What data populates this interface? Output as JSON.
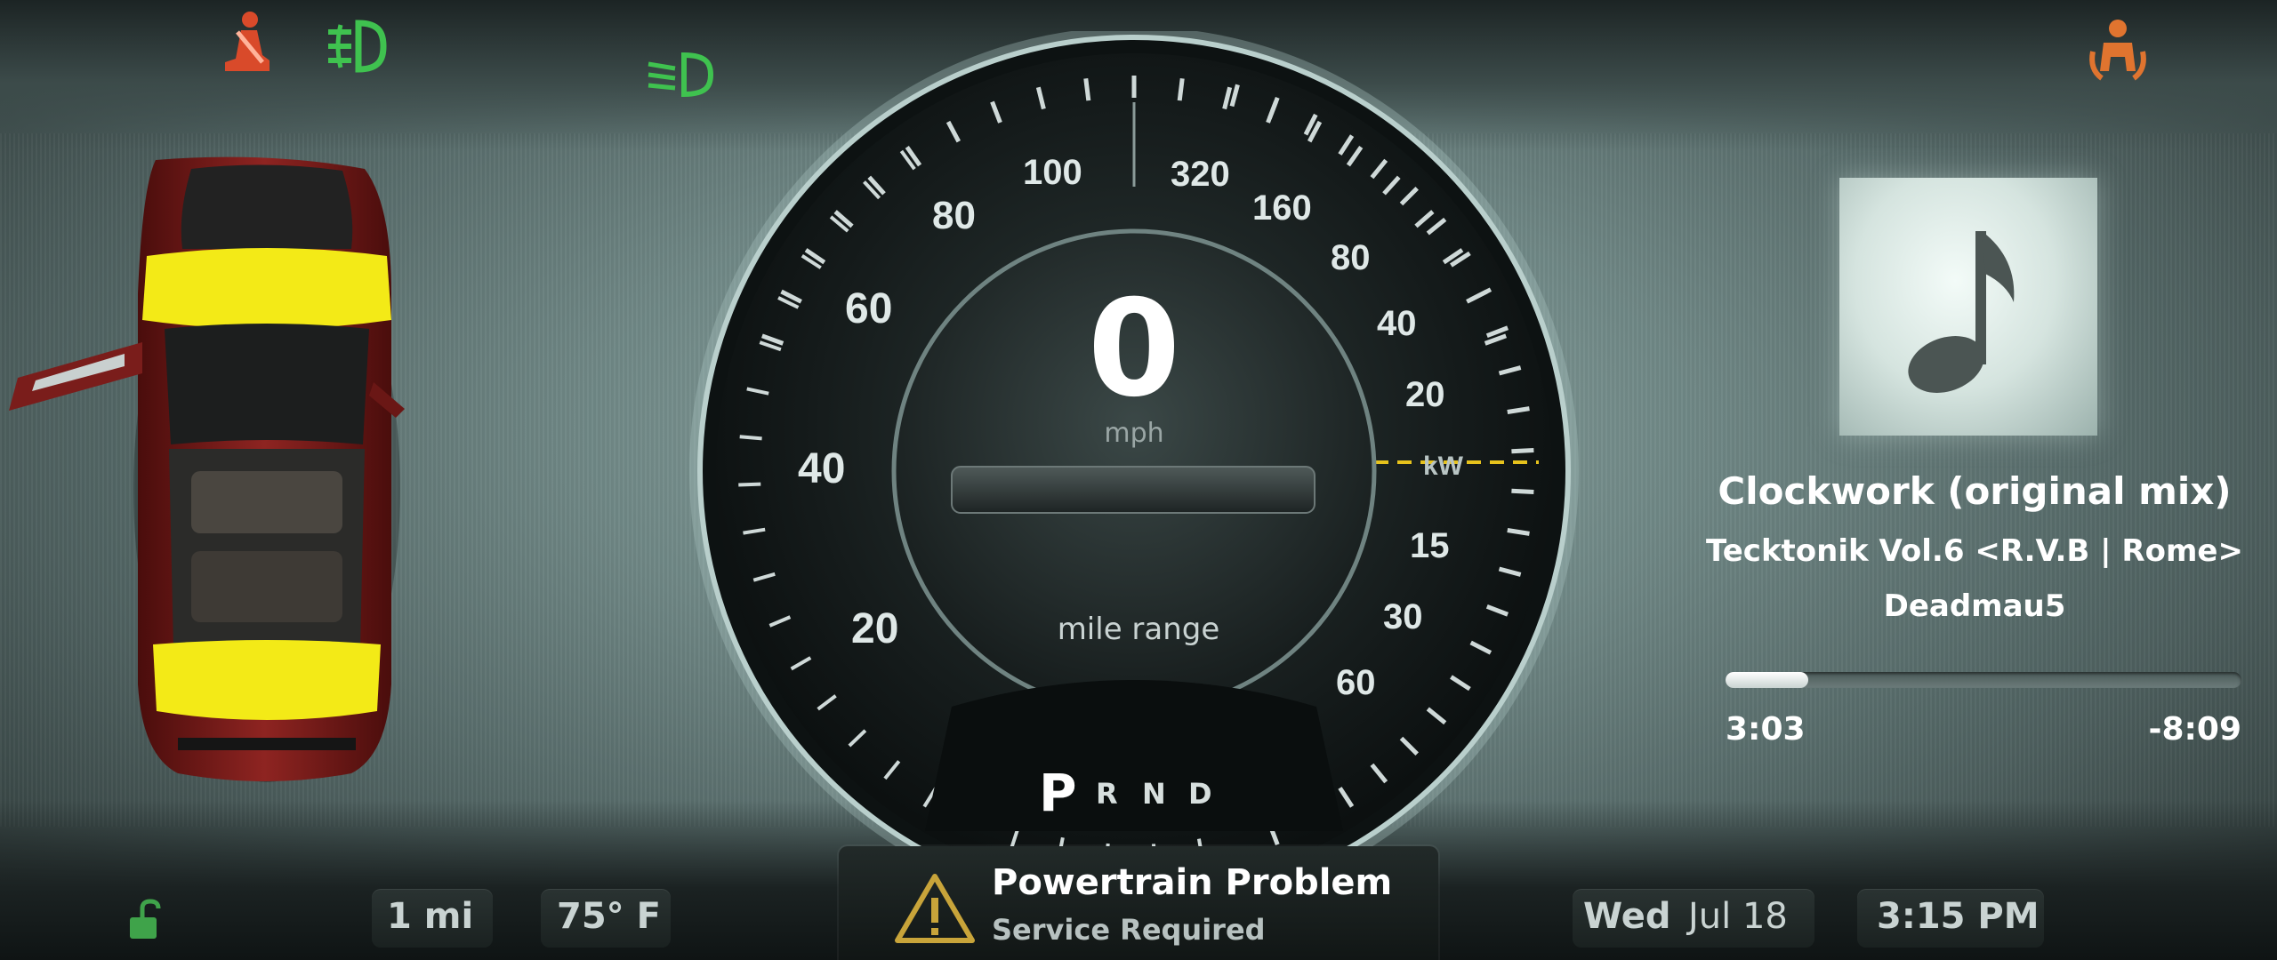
{
  "colors": {
    "indicator_red": "#d94a2a",
    "indicator_green": "#3fc24f",
    "indicator_orange": "#e0742f",
    "door_yellow": "#f3ea17",
    "power_line": "#e6c21c",
    "alert_triangle": "#c8a43a",
    "car_body": "#7c1b1a"
  },
  "indicators": [
    {
      "name": "seatbelt-warning-icon",
      "color": "red"
    },
    {
      "name": "fog-light-icon",
      "color": "green"
    },
    {
      "name": "low-beam-icon",
      "color": "green"
    },
    {
      "name": "passenger-airbag-icon",
      "color": "orange"
    }
  ],
  "car": {
    "view": "top-down",
    "open_doors": [
      "front-left"
    ],
    "highlighted_trunks": [
      "front",
      "rear"
    ]
  },
  "gauge": {
    "speed": "0",
    "speed_unit": "mph",
    "range_label": "mile range",
    "range_bar_fraction": 0,
    "speed_ticks": [
      "20",
      "40",
      "60",
      "80",
      "100"
    ],
    "power_ticks_upper": [
      "320",
      "160",
      "80",
      "40",
      "20"
    ],
    "power_unit": "kW",
    "power_ticks_lower": [
      "15",
      "30",
      "60"
    ]
  },
  "gear_selector": {
    "active": "P",
    "others": [
      "R",
      "N",
      "D"
    ]
  },
  "media": {
    "album_art_icon": "music-note-icon",
    "title": "Clockwork (original mix)",
    "album": "Tecktonik Vol.6 <R.V.B | Rome>",
    "artist": "Deadmau5",
    "elapsed": "3:03",
    "remaining": "-8:09",
    "progress": 0.16
  },
  "status_bar": {
    "lock_icon": "unlocked-padlock-icon",
    "trip": "1 mi",
    "temperature": "75° F",
    "day": "Wed",
    "date": "Jul 18",
    "time": "3:15 PM"
  },
  "alert": {
    "icon": "warning-triangle-icon",
    "title": "Powertrain Problem",
    "subtitle": "Service Required"
  }
}
